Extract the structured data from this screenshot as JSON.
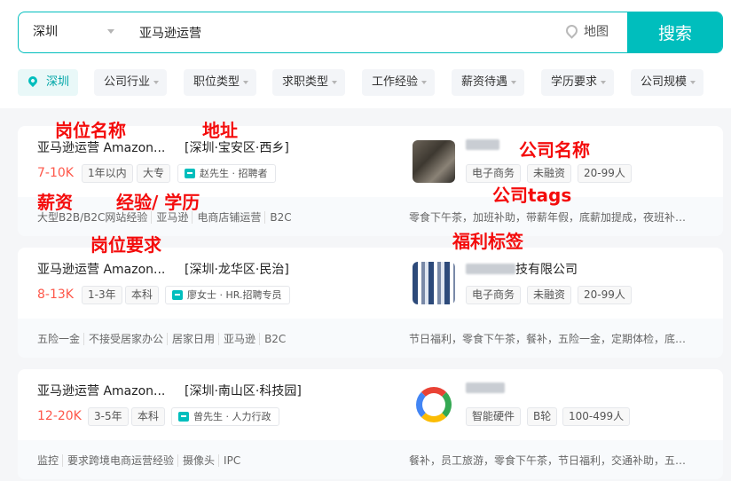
{
  "search": {
    "city": "深圳",
    "query": "亚马逊运营",
    "map_label": "地图",
    "button_label": "搜索"
  },
  "filters": [
    {
      "label": "深圳"
    },
    {
      "label": "公司行业"
    },
    {
      "label": "职位类型"
    },
    {
      "label": "求职类型"
    },
    {
      "label": "工作经验"
    },
    {
      "label": "薪资待遇"
    },
    {
      "label": "学历要求"
    },
    {
      "label": "公司规模"
    }
  ],
  "jobs": [
    {
      "title": "亚马逊运营 Amazon...",
      "area": "[深圳·宝安区·西乡]",
      "salary": "7-10K",
      "experience": "1年以内",
      "education": "大专",
      "hr": "赵先生 · 招聘者",
      "skills": [
        "大型B2B/B2C网站经验",
        "亚马逊",
        "电商店铺运营",
        "B2C"
      ],
      "company_name": "",
      "company_tags": [
        "电子商务",
        "未融资",
        "20-99人"
      ],
      "welfare": "零食下午茶，加班补助，带薪年假，底薪加提成，夜班补助..."
    },
    {
      "title": "亚马逊运营 Amazon...",
      "area": "[深圳·龙华区·民治]",
      "salary": "8-13K",
      "experience": "1-3年",
      "education": "本科",
      "hr": "廖女士 · HR.招聘专员",
      "skills": [
        "五险一金",
        "不接受居家办公",
        "居家日用",
        "亚马逊",
        "B2C"
      ],
      "company_name": "技有限公司",
      "company_tags": [
        "电子商务",
        "未融资",
        "20-99人"
      ],
      "welfare": "节日福利，零食下午茶，餐补，五险一金，定期体检，底薪..."
    },
    {
      "title": "亚马逊运营 Amazon...",
      "area": "[深圳·南山区·科技园]",
      "salary": "12-20K",
      "experience": "3-5年",
      "education": "本科",
      "hr": "曾先生 · 人力行政",
      "skills": [
        "监控",
        "要求跨境电商运营经验",
        "摄像头",
        "IPC"
      ],
      "company_name": "",
      "company_tags": [
        "智能硬件",
        "B轮",
        "100-499人"
      ],
      "welfare": "餐补，员工旅游，零食下午茶，节日福利，交通补助，五险..."
    }
  ],
  "annotations": {
    "job_title": "岗位名称",
    "address": "地址",
    "company_name": "公司名称",
    "salary": "薪资",
    "experience_education": "经验/ 学历",
    "company_tags": "公司tags",
    "job_requirements": "岗位要求",
    "welfare": "福利标签"
  },
  "colors": {
    "accent": "#00bebd",
    "salary": "#fe574a",
    "annotation": "#f40c0c"
  }
}
